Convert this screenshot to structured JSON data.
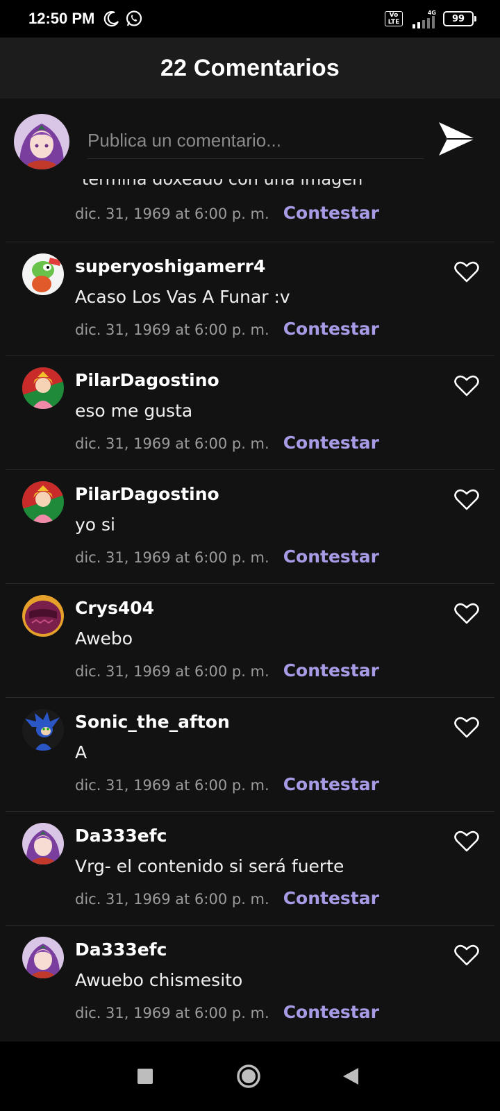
{
  "status_bar": {
    "time": "12:50 PM",
    "network": "4G",
    "volte": "Vo LTE",
    "battery": "99"
  },
  "header": {
    "title": "22 Comentarios"
  },
  "compose": {
    "placeholder": "Publica un comentario..."
  },
  "partial_comment": {
    "text": "termina doxeado con una imagen",
    "date": "dic. 31, 1969 at 6:00 p. m.",
    "reply": "Contestar"
  },
  "comments": [
    {
      "username": "superyoshigamerr4",
      "text": "Acaso Los Vas A Funar :v",
      "date": "dic. 31, 1969 at 6:00 p. m.",
      "reply": "Contestar"
    },
    {
      "username": "PilarDagostino",
      "text": "eso me gusta",
      "date": "dic. 31, 1969 at 6:00 p. m.",
      "reply": "Contestar"
    },
    {
      "username": "PilarDagostino",
      "text": "yo si",
      "date": "dic. 31, 1969 at 6:00 p. m.",
      "reply": "Contestar"
    },
    {
      "username": "Crys404",
      "text": "Awebo",
      "date": "dic. 31, 1969 at 6:00 p. m.",
      "reply": "Contestar"
    },
    {
      "username": "Sonic_the_afton",
      "text": "A",
      "date": "dic. 31, 1969 at 6:00 p. m.",
      "reply": "Contestar"
    },
    {
      "username": "Da333efc",
      "text": "Vrg- el contenido si será fuerte",
      "date": "dic. 31, 1969 at 6:00 p. m.",
      "reply": "Contestar"
    },
    {
      "username": "Da333efc",
      "text": "Awuebo chismesito",
      "date": "dic. 31, 1969 at 6:00 p. m.",
      "reply": "Contestar"
    }
  ],
  "colors": {
    "background": "#121212",
    "header": "#1c1c1c",
    "accent": "#a79be6",
    "muted": "#9b9b9b"
  },
  "icons": [
    "moon-icon",
    "whatsapp-icon",
    "signal-icon",
    "battery-icon",
    "send-icon",
    "heart-outline-icon",
    "nav-recents-icon",
    "nav-home-icon",
    "nav-back-icon"
  ]
}
